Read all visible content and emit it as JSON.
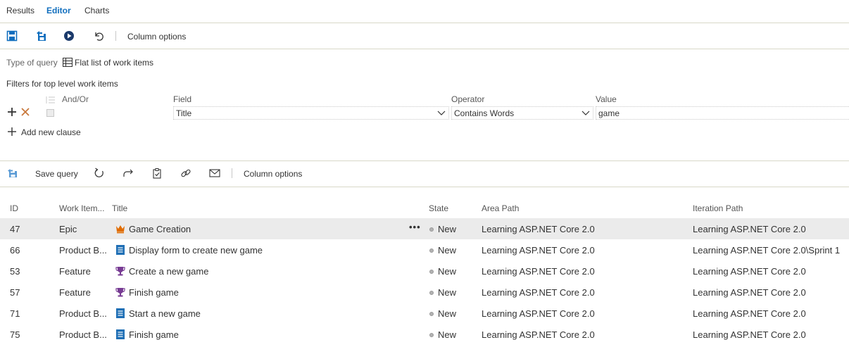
{
  "tabs": [
    {
      "label": "Results",
      "active": false
    },
    {
      "label": "Editor",
      "active": true
    },
    {
      "label": "Charts",
      "active": false
    }
  ],
  "editor_toolbar": {
    "save_icon": "save-icon",
    "save_as_icon": "save-as-icon",
    "run_icon": "run-query-icon",
    "undo_icon": "undo-icon",
    "column_options_label": "Column options"
  },
  "query_type": {
    "label": "Type of query",
    "icon": "table-icon",
    "value": "Flat list of work items"
  },
  "filters": {
    "section_label": "Filters for top level work items",
    "and_or_label": "And/Or",
    "field_label": "Field",
    "operator_label": "Operator",
    "value_label": "Value",
    "clause": {
      "field": "Title",
      "operator": "Contains Words",
      "value": "game"
    },
    "add_clause_label": "Add new clause"
  },
  "results_toolbar": {
    "save_query_label": "Save query",
    "column_options_label": "Column options"
  },
  "colors": {
    "accent": "#106ebe",
    "epic": "#e06c00",
    "feature": "#773b93",
    "backlog_item": "#009ccc",
    "state_new": "#b2b2b2",
    "selected_row": "#ebebeb"
  },
  "table": {
    "columns": [
      "ID",
      "Work Item...",
      "Title",
      "State",
      "Area Path",
      "Iteration Path"
    ],
    "rows": [
      {
        "id": "47",
        "type": "Epic",
        "icon": "crown-icon",
        "title": "Game Creation",
        "state": "New",
        "area": "Learning ASP.NET Core 2.0",
        "iteration": "Learning ASP.NET Core 2.0",
        "selected": true
      },
      {
        "id": "66",
        "type": "Product B...",
        "icon": "backlog-item-icon",
        "title": "Display form to create new game",
        "state": "New",
        "area": "Learning ASP.NET Core 2.0",
        "iteration": "Learning ASP.NET Core 2.0\\Sprint 1",
        "selected": false
      },
      {
        "id": "53",
        "type": "Feature",
        "icon": "trophy-icon",
        "title": "Create a new game",
        "state": "New",
        "area": "Learning ASP.NET Core 2.0",
        "iteration": "Learning ASP.NET Core 2.0",
        "selected": false
      },
      {
        "id": "57",
        "type": "Feature",
        "icon": "trophy-icon",
        "title": "Finish game",
        "state": "New",
        "area": "Learning ASP.NET Core 2.0",
        "iteration": "Learning ASP.NET Core 2.0",
        "selected": false
      },
      {
        "id": "71",
        "type": "Product B...",
        "icon": "backlog-item-icon",
        "title": "Start a new game",
        "state": "New",
        "area": "Learning ASP.NET Core 2.0",
        "iteration": "Learning ASP.NET Core 2.0",
        "selected": false
      },
      {
        "id": "75",
        "type": "Product B...",
        "icon": "backlog-item-icon",
        "title": "Finish game",
        "state": "New",
        "area": "Learning ASP.NET Core 2.0",
        "iteration": "Learning ASP.NET Core 2.0",
        "selected": false
      }
    ]
  }
}
